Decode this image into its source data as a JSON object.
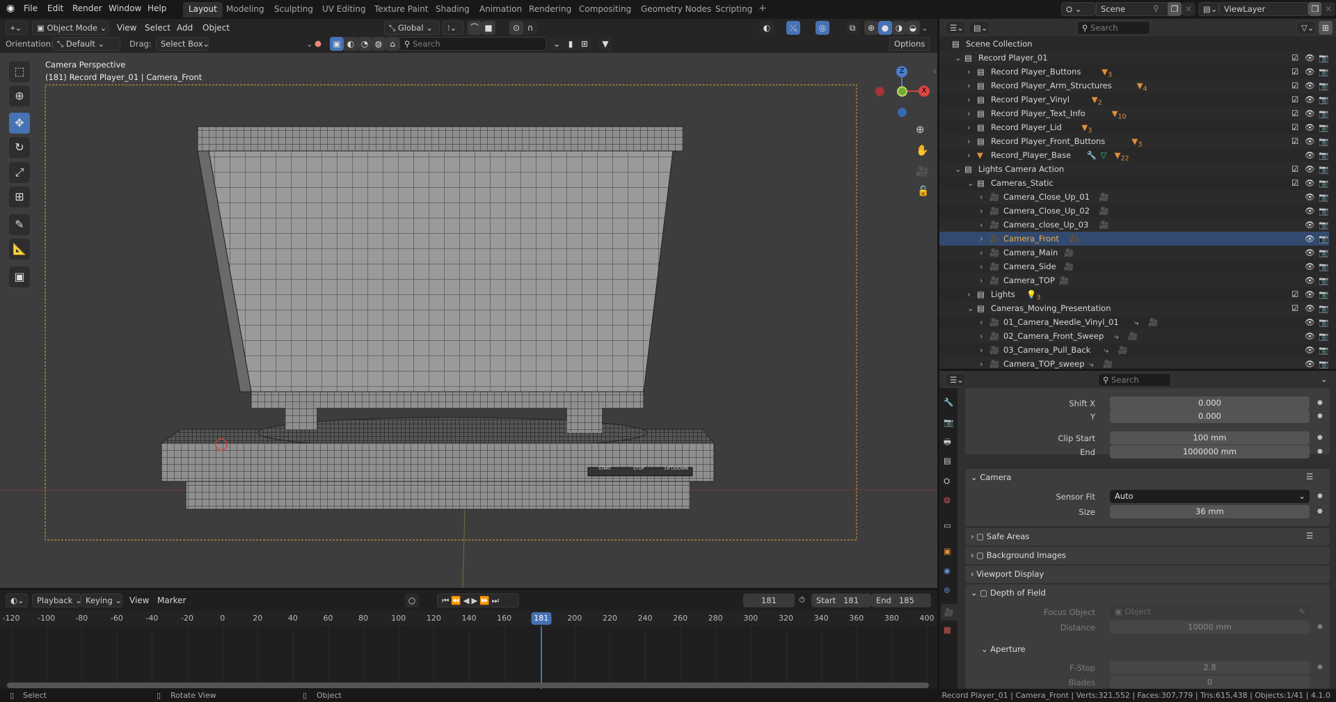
{
  "menu": [
    "File",
    "Edit",
    "Render",
    "Window",
    "Help"
  ],
  "workspaces": [
    "Layout",
    "Modeling",
    "Sculpting",
    "UV Editing",
    "Texture Paint",
    "Shading",
    "Animation",
    "Rendering",
    "Compositing",
    "Geometry Nodes",
    "Scripting"
  ],
  "active_workspace": "Layout",
  "scene": {
    "name": "Scene",
    "view_layer": "ViewLayer"
  },
  "viewport": {
    "mode": "Object Mode",
    "menus": [
      "View",
      "Select",
      "Add",
      "Object"
    ],
    "transform_orientation": "Global",
    "orientation_label": "Orientation:",
    "orientation_value": "Default",
    "drag_label": "Drag:",
    "drag_value": "Select Box",
    "search_placeholder": "Search",
    "options_label": "Options",
    "overlay_title": "Camera Perspective",
    "overlay_subtitle": "(181) Record Player_01 | Camera_Front",
    "gizmo": {
      "z": "Z",
      "x": "X"
    },
    "panel_labels": [
      "START",
      "STOP",
      "LIFT/DOWN"
    ]
  },
  "timeline": {
    "menus": [
      "Playback",
      "Keying",
      "View",
      "Marker"
    ],
    "current_frame": "181",
    "start_label": "Start",
    "start": "181",
    "end_label": "End",
    "end": "185",
    "ticks": [
      "-120",
      "-100",
      "-80",
      "-60",
      "-40",
      "-20",
      "0",
      "20",
      "40",
      "60",
      "80",
      "100",
      "120",
      "140",
      "160",
      "200",
      "220",
      "240",
      "260",
      "280",
      "300",
      "320",
      "340",
      "360",
      "380",
      "400"
    ],
    "range": [
      -120,
      400
    ],
    "accent": "#4772b3"
  },
  "status": {
    "hints": [
      "Select",
      "Rotate View",
      "Object"
    ],
    "info": "Record Player_01 | Camera_Front | Verts:321,552 | Faces:307,779 | Tris:615,438 | Objects:1/41 | 4.1.0"
  },
  "outliner": {
    "search_placeholder": "Search",
    "rows": [
      {
        "name": "Scene Collection",
        "level": 0,
        "icon": "collection",
        "expand": "none"
      },
      {
        "name": "Record Player_01",
        "level": 1,
        "icon": "collection",
        "expand": "open",
        "check": true
      },
      {
        "name": "Record Player_Buttons",
        "level": 2,
        "icon": "collection",
        "expand": "closed",
        "check": true,
        "badge": "3"
      },
      {
        "name": "Record Player_Arm_Structures",
        "level": 2,
        "icon": "collection",
        "expand": "closed",
        "check": true,
        "badge": "4"
      },
      {
        "name": "Record Player_Vinyl",
        "level": 2,
        "icon": "collection",
        "expand": "closed",
        "check": true,
        "badge": "2"
      },
      {
        "name": "Record Player_Text_Info",
        "level": 2,
        "icon": "collection",
        "expand": "closed",
        "check": true,
        "badge": "10"
      },
      {
        "name": "Record Player_Lid",
        "level": 2,
        "icon": "collection",
        "expand": "closed",
        "check": true,
        "badge": "3"
      },
      {
        "name": "Record Player_Front_Buttons",
        "level": 2,
        "icon": "collection",
        "expand": "closed",
        "check": true,
        "badge": "3"
      },
      {
        "name": "Record_Player_Base",
        "level": 2,
        "icon": "mesh",
        "expand": "closed",
        "extra": "modifier-mesh",
        "badge": "22"
      },
      {
        "name": "Lights Camera Action",
        "level": 1,
        "icon": "collection",
        "expand": "open",
        "check": true
      },
      {
        "name": "Cameras_Static",
        "level": 2,
        "icon": "collection",
        "expand": "open",
        "check": true
      },
      {
        "name": "Camera_Close_Up_01",
        "level": 3,
        "icon": "camera",
        "expand": "closed",
        "cam": true
      },
      {
        "name": "Camera_Close_Up_02",
        "level": 3,
        "icon": "camera",
        "expand": "closed",
        "cam": true
      },
      {
        "name": "Camera_close_Up_03",
        "level": 3,
        "icon": "camera",
        "expand": "closed",
        "cam": true
      },
      {
        "name": "Camera_Front",
        "level": 3,
        "icon": "camera",
        "expand": "closed",
        "cam": true,
        "selected": true
      },
      {
        "name": "Camera_Main",
        "level": 3,
        "icon": "camera",
        "expand": "closed",
        "cam": true
      },
      {
        "name": "Camera_Side",
        "level": 3,
        "icon": "camera",
        "expand": "closed",
        "cam": true
      },
      {
        "name": "Camera_TOP",
        "level": 3,
        "icon": "camera",
        "expand": "closed",
        "cam": true
      },
      {
        "name": "Lights",
        "level": 2,
        "icon": "collection",
        "expand": "closed",
        "check": true,
        "light": "3"
      },
      {
        "name": "Caneras_Moving_Presentation",
        "level": 2,
        "icon": "collection",
        "expand": "open",
        "check": true
      },
      {
        "name": "01_Camera_Needle_Vinyl_01",
        "level": 3,
        "icon": "camera",
        "expand": "closed",
        "cam": true,
        "anim": true
      },
      {
        "name": "02_Camera_Front_Sweep",
        "level": 3,
        "icon": "camera",
        "expand": "closed",
        "cam": true,
        "anim": true
      },
      {
        "name": "03_Camera_Pull_Back",
        "level": 3,
        "icon": "camera",
        "expand": "closed",
        "cam": true,
        "anim": true
      },
      {
        "name": "Camera_TOP_sweep",
        "level": 3,
        "icon": "camera",
        "expand": "closed",
        "cam": true,
        "anim": true
      }
    ]
  },
  "properties": {
    "search_placeholder": "Search",
    "shift_x_label": "Shift X",
    "shift_x": "0.000",
    "shift_y_label": "Y",
    "shift_y": "0.000",
    "clip_start_label": "Clip Start",
    "clip_start": "100 mm",
    "clip_end_label": "End",
    "clip_end": "1000000 mm",
    "camera_panel": "Camera",
    "sensor_fit_label": "Sensor Fit",
    "sensor_fit": "Auto",
    "size_label": "Size",
    "size": "36 mm",
    "safe_areas": "Safe Areas",
    "background_images": "Background Images",
    "viewport_display": "Viewport Display",
    "depth_of_field": "Depth of Field",
    "focus_object_label": "Focus Object",
    "focus_object_placeholder": "Object",
    "distance_label": "Distance",
    "distance": "10000 mm",
    "aperture": "Aperture",
    "fstop_label": "F-Stop",
    "fstop": "2.8",
    "blades_label": "Blades",
    "blades": "0"
  }
}
